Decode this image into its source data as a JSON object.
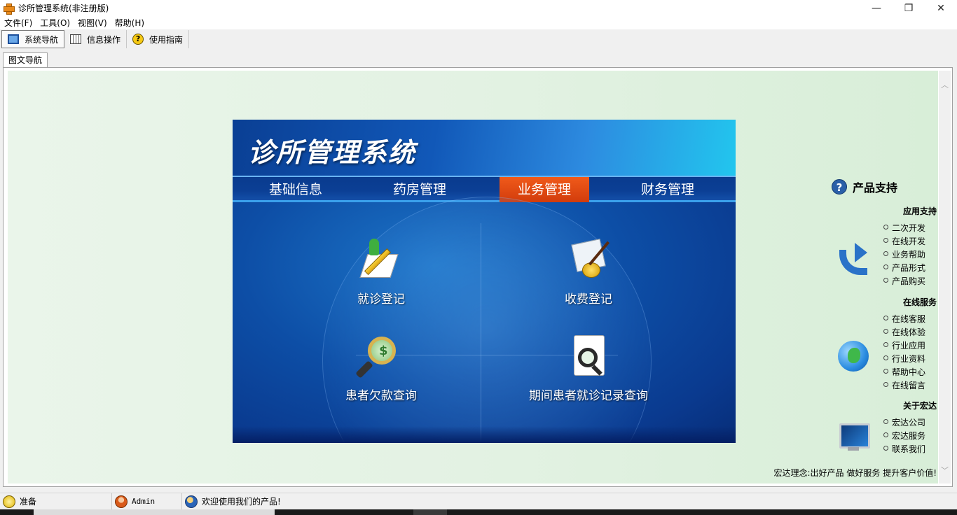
{
  "window": {
    "title": "诊所管理系统(非注册版)",
    "controls": {
      "minimize": "—",
      "maximize": "❐",
      "close": "✕"
    }
  },
  "menu": [
    {
      "label": "文件(F)"
    },
    {
      "label": "工具(O)"
    },
    {
      "label": "视图(V)"
    },
    {
      "label": "帮助(H)"
    }
  ],
  "toolbar": {
    "items": [
      {
        "label": "系统导航",
        "icon": "monitor-icon",
        "active": true
      },
      {
        "label": "信息操作",
        "icon": "grid-icon"
      },
      {
        "label": "使用指南",
        "icon": "help-icon"
      }
    ]
  },
  "tab": {
    "label": "图文导航"
  },
  "banner": {
    "title": "诊所管理系统",
    "nav": [
      {
        "label": "基础信息"
      },
      {
        "label": "药房管理"
      },
      {
        "label": "业务管理",
        "active": true
      },
      {
        "label": "财务管理"
      }
    ],
    "functions": [
      {
        "label": "就诊登记",
        "icon": "register-pencil-icon"
      },
      {
        "label": "收费登记",
        "icon": "fee-coins-icon"
      },
      {
        "label": "患者欠款查询",
        "icon": "debt-magnifier-icon"
      },
      {
        "label": "期间患者就诊记录查询",
        "icon": "record-search-icon"
      }
    ]
  },
  "support": {
    "title": "产品支持",
    "sections": [
      {
        "title": "应用支持",
        "icon": "arrow-icon",
        "links": [
          "二次开发",
          "在线开发",
          "业务帮助",
          "产品形式",
          "产品购买"
        ]
      },
      {
        "title": "在线服务",
        "icon": "globe-icon",
        "links": [
          "在线客服",
          "在线体验",
          "行业应用",
          "行业资料",
          "帮助中心",
          "在线留言"
        ]
      },
      {
        "title": "关于宏达",
        "icon": "monitor-icon",
        "links": [
          "宏达公司",
          "宏达服务",
          "联系我们"
        ]
      }
    ],
    "motto": "宏达理念:出好产品 做好服务 提升客户价值!"
  },
  "status": {
    "ready": "准备",
    "user": "Admin",
    "welcome": "欢迎使用我们的产品!"
  },
  "colors": {
    "panel_blue": "#0d4ea6",
    "active_tab_orange": "#e04a12",
    "content_bg": "#e3f2e3"
  }
}
